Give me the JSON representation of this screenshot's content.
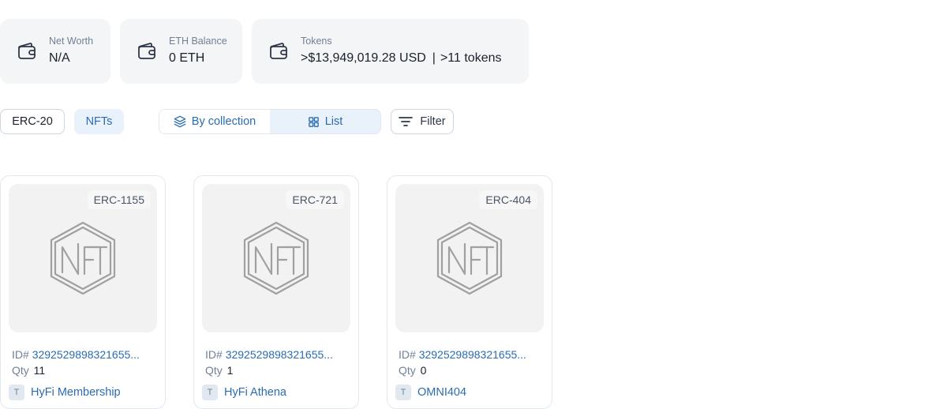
{
  "stats": {
    "net_worth": {
      "label": "Net Worth",
      "value": "N/A"
    },
    "eth_balance": {
      "label": "ETH Balance",
      "value": "0 ETH"
    },
    "tokens": {
      "label": "Tokens",
      "value": ">$13,949,019.28 USD",
      "separator": "|",
      "count": ">11 tokens"
    }
  },
  "tabs": {
    "erc20": "ERC-20",
    "nfts": "NFTs",
    "active": "nfts"
  },
  "view_toggle": {
    "by_collection": "By collection",
    "list": "List",
    "active": "by_collection"
  },
  "filter": {
    "label": "Filter"
  },
  "labels": {
    "id_prefix": "ID#",
    "qty_prefix": "Qty"
  },
  "nfts": [
    {
      "standard": "ERC-1155",
      "id": "3292529898321655...",
      "qty": "11",
      "collection_initial": "T",
      "collection": "HyFi Membership"
    },
    {
      "standard": "ERC-721",
      "id": "3292529898321655...",
      "qty": "1",
      "collection_initial": "T",
      "collection": "HyFi Athena"
    },
    {
      "standard": "ERC-404",
      "id": "3292529898321655...",
      "qty": "0",
      "collection_initial": "T",
      "collection": "OMNI404"
    }
  ],
  "colors": {
    "accent": "#2b6cb0",
    "muted": "#718096",
    "card_bg": "#f4f5f6",
    "selected_bg": "#e9f1fb"
  },
  "icons": {
    "wallet": "wallet-icon",
    "layers": "layers-icon",
    "grid": "grid-icon",
    "filter": "filter-icon",
    "nft_placeholder": "nft-placeholder-icon"
  }
}
